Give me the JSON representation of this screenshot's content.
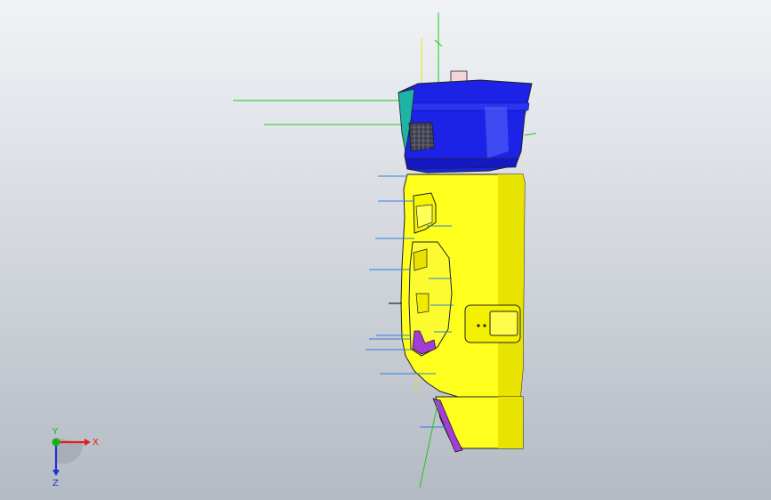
{
  "viewport": {
    "background_top": "#f1f3f6",
    "background_bottom": "#b4bac3"
  },
  "model": {
    "colors": {
      "body": "#ffff1e",
      "body_shade": "#d9d400",
      "cap": "#1c22e6",
      "cap_shade": "#0a0fa8",
      "accent": "#a63cd6",
      "teal": "#1fb3a6",
      "leader_green": "#1cc81c",
      "leader_blue": "#2f7fd9",
      "leader_yellow": "#e6e600",
      "edge": "#202020"
    }
  },
  "triad": {
    "x_label": "X",
    "y_label": "Y",
    "z_label": "Z",
    "x_color": "#e31b1b",
    "y_color": "#16b316",
    "z_color": "#1b33d9"
  }
}
